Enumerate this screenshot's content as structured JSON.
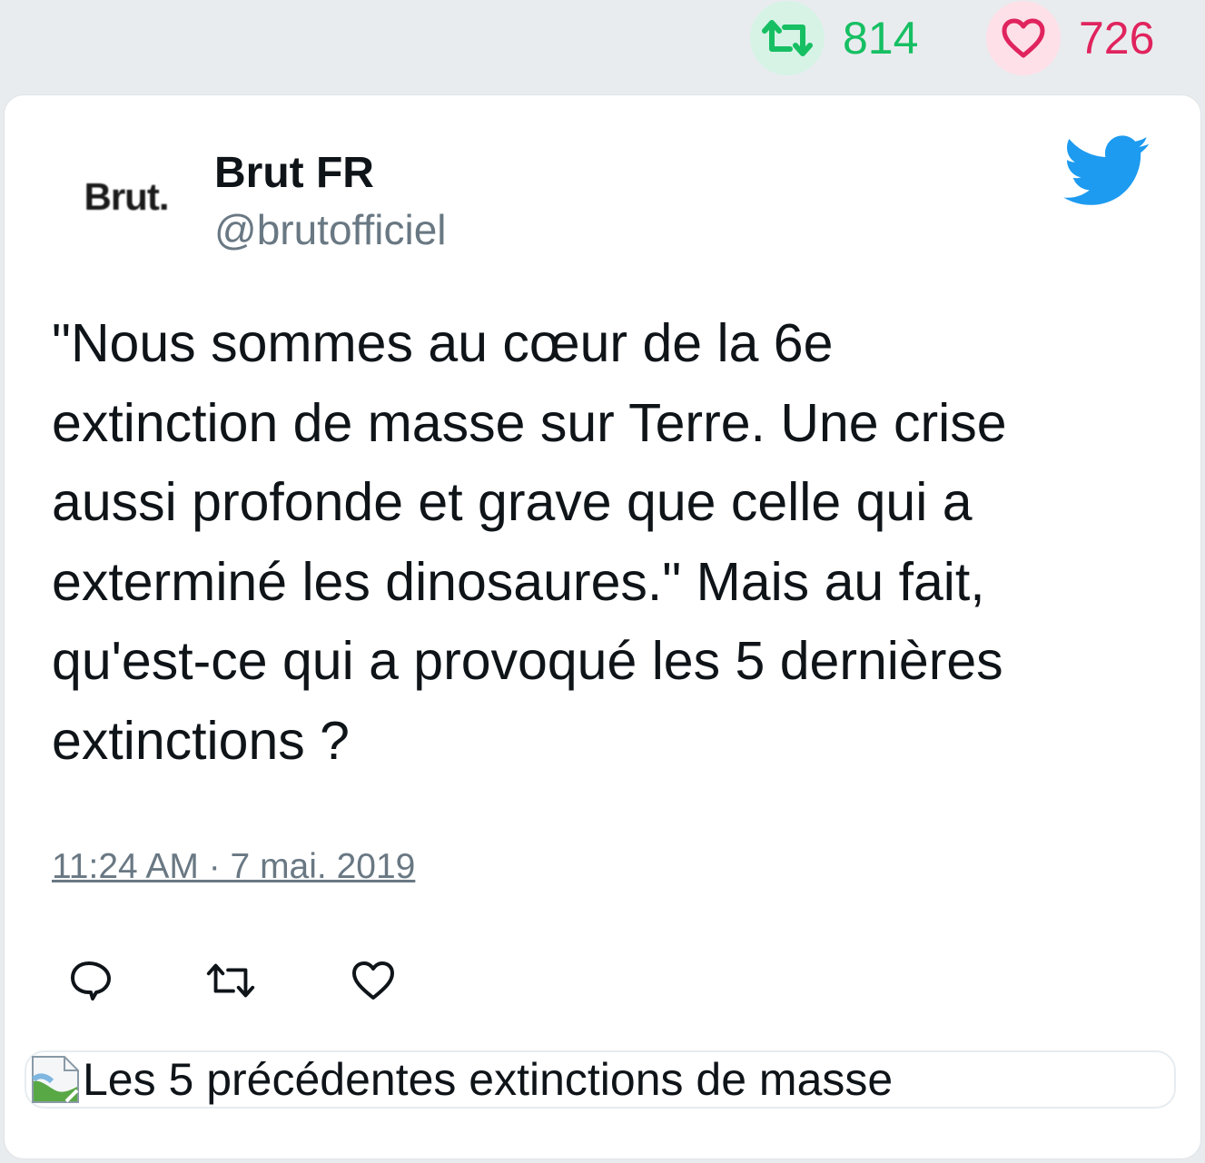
{
  "stats": {
    "retweets": "814",
    "likes": "726"
  },
  "tweet": {
    "avatar_text": "Brut.",
    "author_name": "Brut FR",
    "author_handle": "@brutofficiel",
    "text": "\"Nous sommes au cœur de la 6e\nextinction de masse sur Terre. Une crise\naussi profonde et grave que celle qui a\nexterminé les dinosaures.\" Mais au fait,\nqu'est-ce qui a provoqué les 5 dernières\nextinctions ?",
    "timestamp": "11:24 AM · 7 mai. 2019",
    "link_preview_title": "Les 5 précédentes extinctions de masse"
  },
  "icons": {
    "retweet": "retweet-icon",
    "like": "heart-icon",
    "reply": "reply-icon",
    "twitter": "twitter-bird-icon",
    "broken_image": "broken-image-icon"
  },
  "colors": {
    "retweet_green": "#17bf63",
    "like_red": "#e0245e",
    "twitter_blue": "#1d9bf0",
    "muted_text": "#697883"
  }
}
